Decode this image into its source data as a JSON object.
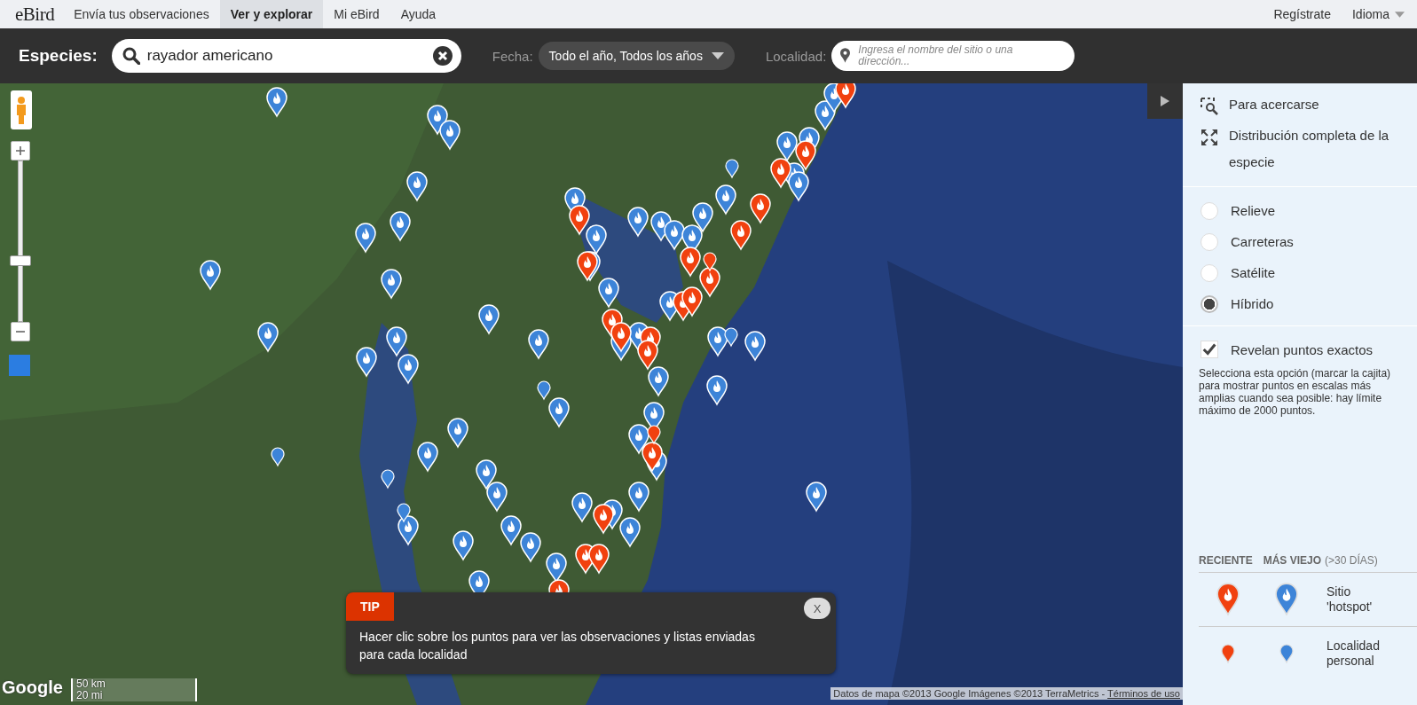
{
  "nav": {
    "logo": "eBird",
    "items": [
      {
        "label": "Envía tus observaciones",
        "selected": false
      },
      {
        "label": "Ver y explorar",
        "selected": true
      },
      {
        "label": "Mi eBird",
        "selected": false
      },
      {
        "label": "Ayuda",
        "selected": false
      }
    ],
    "register": "Regístrate",
    "language": "Idioma"
  },
  "toolbar": {
    "species_label": "Especies:",
    "species_value": "rayador americano",
    "date_label": "Fecha:",
    "date_value": "Todo el año, Todos los años",
    "location_label": "Localidad:",
    "location_placeholder": "Ingresa el nombre del sitio o una dirección..."
  },
  "map": {
    "zoom_slider": {
      "level": 0.38
    },
    "scale": [
      "50 km",
      "20 mi"
    ],
    "logo": "Google",
    "attribution": "Datos de mapa ©2013 Google Imágenes ©2013 TerraMetrics - ",
    "terms_link": "Términos de uso",
    "tip": {
      "badge": "TIP",
      "close": "X",
      "text": "Hacer clic sobre los puntos para ver las observaciones y listas enviadas para cada localidad"
    }
  },
  "panel": {
    "tools": [
      {
        "kind": "zoom",
        "label": "Para acercarse"
      },
      {
        "kind": "full",
        "label": "Distribución completa de la especie"
      }
    ],
    "map_types": [
      {
        "label": "Relieve",
        "selected": false
      },
      {
        "label": "Carreteras",
        "selected": false
      },
      {
        "label": "Satélite",
        "selected": false
      },
      {
        "label": "Híbrido",
        "selected": true
      }
    ],
    "exact_points": {
      "label": "Revelan puntos exactos",
      "checked": true,
      "description": "Selecciona esta opción (marcar la cajita) para mostrar puntos en escalas más amplias cuando sea posible: hay límite máximo de 2000 puntos."
    },
    "legend": {
      "recent": "RECIENTE",
      "older": "MÁS VIEJO",
      "older_note": "(>30 DÍAS)",
      "rows": [
        {
          "kind": "hotspot",
          "label": "Sitio 'hotspot'"
        },
        {
          "kind": "personal",
          "label": "Localidad personal"
        }
      ]
    }
  }
}
